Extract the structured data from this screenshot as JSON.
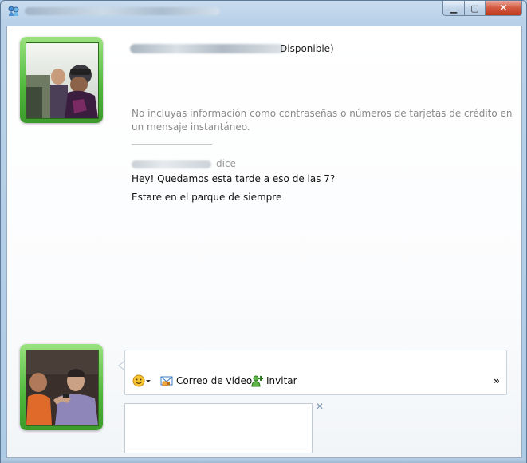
{
  "window": {
    "minimize": "▁",
    "maximize": "▢",
    "close": "✕"
  },
  "contact": {
    "status": "Disponible)"
  },
  "conversation": {
    "privacy_notice": "No incluyas información como contraseñas o números de tarjetas de crédito en un mensaje instantáneo.",
    "sender_suffix": "dice",
    "messages": [
      "Hey! Quedamos esta tarde a eso de las 7?",
      "Estare en el parque de siempre"
    ]
  },
  "toolbar": {
    "video_mail_label": "Correo de vídeo",
    "invite_label": "Invitar",
    "more_label": "»"
  },
  "ad": {
    "close_label": "✕"
  },
  "colors": {
    "avatar_frame": "#4fb63b",
    "privacy_text": "#8a8a8a",
    "close_button": "#c0391f"
  }
}
